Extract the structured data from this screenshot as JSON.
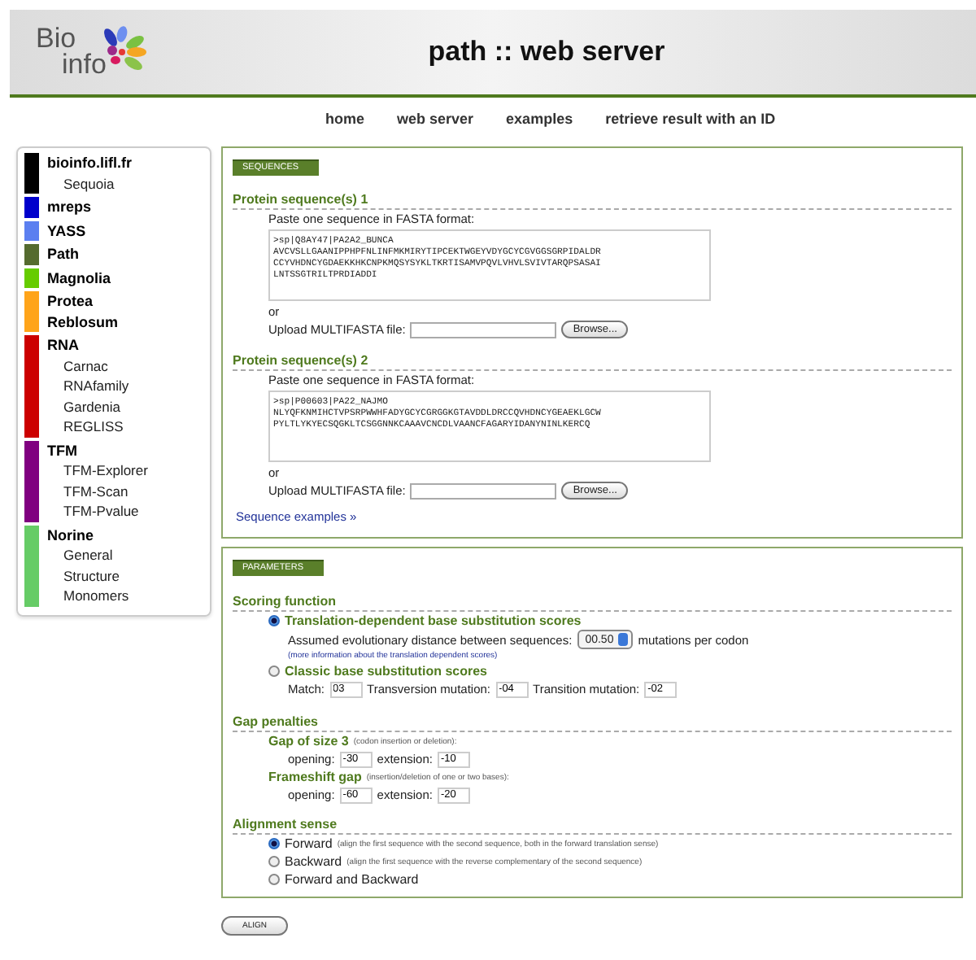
{
  "logo": {
    "line1": "Bio",
    "line2": "info"
  },
  "title": "path :: web server",
  "nav": [
    {
      "label": "home"
    },
    {
      "label": "web server"
    },
    {
      "label": "examples"
    },
    {
      "label": "retrieve result with an ID"
    }
  ],
  "sidebar": [
    {
      "titles": [
        "bioinfo.lifl.fr"
      ],
      "color": "#000000",
      "children": [
        "Sequoia"
      ]
    },
    {
      "titles": [
        "mreps"
      ],
      "color": "#0000cc"
    },
    {
      "titles": [
        "YASS"
      ],
      "color": "#5b7ff0"
    },
    {
      "titles": [
        "Path"
      ],
      "color": "#556b2f"
    },
    {
      "titles": [
        "Magnolia"
      ],
      "color": "#66cc00"
    },
    {
      "titles": [
        "Protea",
        "Reblosum"
      ],
      "color": "#ffa41a"
    },
    {
      "titles": [
        "RNA"
      ],
      "color": "#cc0000",
      "children": [
        "Carnac",
        "RNAfamily",
        "Gardenia",
        "REGLISS"
      ]
    },
    {
      "titles": [
        "TFM"
      ],
      "color": "#800080",
      "children": [
        "TFM-Explorer",
        "TFM-Scan",
        "TFM-Pvalue"
      ]
    },
    {
      "titles": [
        "Norine"
      ],
      "color": "#66cc66",
      "children": [
        "General",
        "Structure",
        "Monomers"
      ]
    }
  ],
  "sequences": {
    "legend": "SEQUENCES",
    "inputs": [
      {
        "heading": "Protein sequence(s) 1",
        "paste_label": "Paste one sequence in FASTA format:",
        "value": ">sp|Q8AY47|PA2A2_BUNCA\nAVCVSLLGAANIPPHPFNLINFMKMIRYTIPCEKTWGEYVDYGCYCGVGGSGRPIDALDR\nCCYVHDNCYGDAEKKHKCNPKMQSYSYKLTKRTISAMVPQVLVHVLSVIVTARQPSASAI\nLNTSSGTRILTPRDIADDI",
        "or": "or",
        "upload_label": "Upload MULTIFASTA file:",
        "browse": "Browse..."
      },
      {
        "heading": "Protein sequence(s) 2",
        "paste_label": "Paste one sequence in FASTA format:",
        "value": ">sp|P00603|PA22_NAJMO\nNLYQFKNMIHCTVPSRPWWHFADYGCYCGRGGKGTAVDDLDRCCQVHDNCYGEAEKLGCW\nPYLTLYKYECSQGKLTCSGGNNKCAAAVCNCDLVAANCFAGARYIDANYNINLKERCQ",
        "or": "or",
        "upload_label": "Upload MULTIFASTA file:",
        "browse": "Browse..."
      }
    ],
    "examples_link": "Sequence examples »"
  },
  "parameters": {
    "legend": "PARAMETERS",
    "scoring": {
      "heading": "Scoring function",
      "translation": {
        "label": "Translation-dependent base substitution scores",
        "selected": true,
        "distance_label": "Assumed evolutionary distance between sequences:",
        "distance_value": "00.50",
        "distance_unit": "mutations per codon",
        "info_link": "(more information about the translation dependent scores)"
      },
      "classic": {
        "label": "Classic base substitution scores",
        "selected": false,
        "fields": [
          {
            "label": "Match:",
            "value": "03"
          },
          {
            "label": "Transversion mutation:",
            "value": "-04"
          },
          {
            "label": "Transition mutation:",
            "value": "-02"
          }
        ]
      }
    },
    "gaps": {
      "heading": "Gap penalties",
      "items": [
        {
          "label": "Gap of size 3",
          "note": "(codon insertion or deletion):",
          "fields": [
            {
              "label": "opening:",
              "value": "-30"
            },
            {
              "label": "extension:",
              "value": "-10"
            }
          ]
        },
        {
          "label": "Frameshift gap",
          "note": "(insertion/deletion of one or two bases):",
          "fields": [
            {
              "label": "opening:",
              "value": "-60"
            },
            {
              "label": "extension:",
              "value": "-20"
            }
          ]
        }
      ]
    },
    "sense": {
      "heading": "Alignment sense",
      "options": [
        {
          "label": "Forward",
          "note": "(align the first sequence with the second sequence, both in the forward translation sense)",
          "selected": true
        },
        {
          "label": "Backward",
          "note": "(align the first sequence with the reverse complementary of the second sequence)",
          "selected": false
        },
        {
          "label": "Forward and Backward",
          "selected": false
        }
      ]
    }
  },
  "submit": "ALIGN"
}
